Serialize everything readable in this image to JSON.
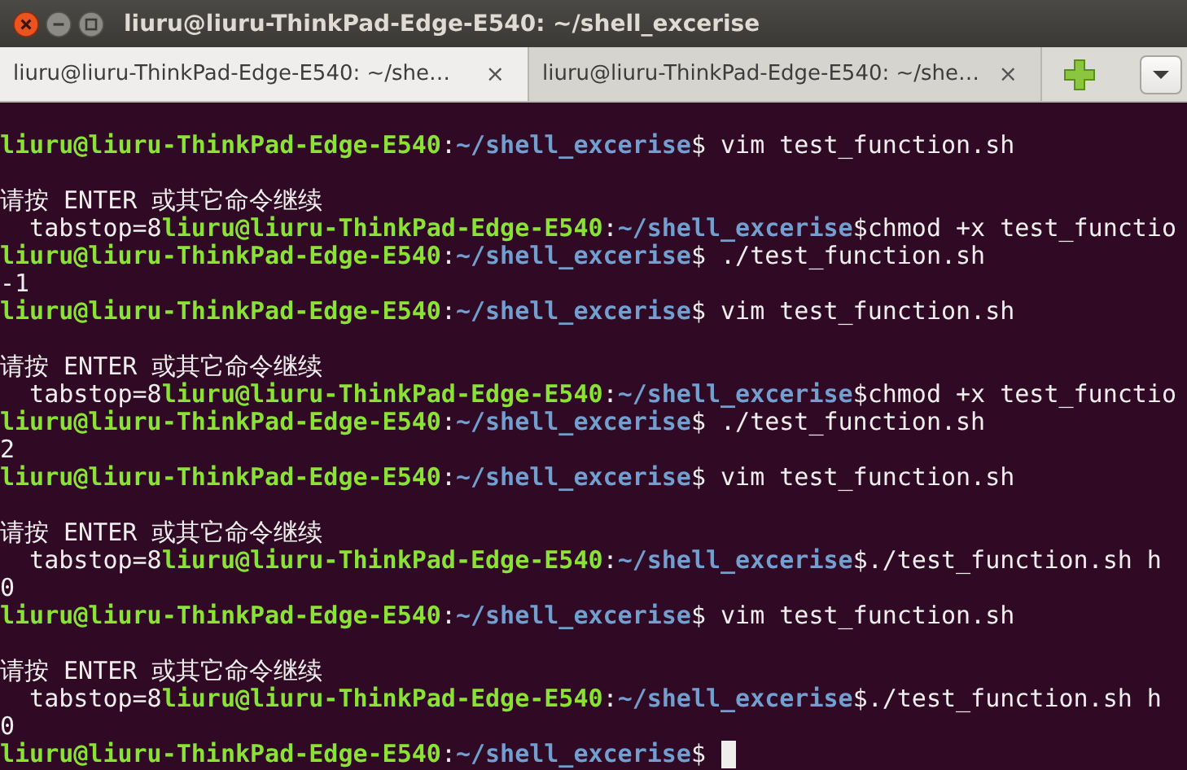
{
  "window": {
    "title": "liuru@liuru-ThinkPad-Edge-E540: ~/shell_excerise"
  },
  "tabs": [
    {
      "label": "liuru@liuru-ThinkPad-Edge-E540: ~/she…",
      "close": "×",
      "selected": true
    },
    {
      "label": "liuru@liuru-ThinkPad-Edge-E540: ~/she…",
      "close": "×",
      "selected": false
    }
  ],
  "terminal": {
    "lines": [
      {
        "kind": "output",
        "segments": [
          {
            "kind": "user",
            "text": "liuru@liuru-ThinkPad-Edge-E540"
          },
          {
            "kind": "plain",
            "text": ":"
          },
          {
            "kind": "path",
            "text": "~/shell_excerise"
          },
          {
            "kind": "plain",
            "text": "$ vim test_function.sh"
          }
        ]
      },
      {
        "kind": "blank"
      },
      {
        "kind": "output",
        "segments": [
          {
            "kind": "plain",
            "text": "请按 ENTER 或其它命令继续"
          }
        ]
      },
      {
        "kind": "output",
        "segments": [
          {
            "kind": "plain",
            "text": "  tabstop=8"
          },
          {
            "kind": "user",
            "text": "liuru@liuru-ThinkPad-Edge-E540"
          },
          {
            "kind": "plain",
            "text": ":"
          },
          {
            "kind": "path",
            "text": "~/shell_excerise"
          },
          {
            "kind": "plain",
            "text": "$chmod +x test_functio"
          }
        ]
      },
      {
        "kind": "output",
        "segments": [
          {
            "kind": "user",
            "text": "liuru@liuru-ThinkPad-Edge-E540"
          },
          {
            "kind": "plain",
            "text": ":"
          },
          {
            "kind": "path",
            "text": "~/shell_excerise"
          },
          {
            "kind": "plain",
            "text": "$ ./test_function.sh"
          }
        ]
      },
      {
        "kind": "output",
        "segments": [
          {
            "kind": "plain",
            "text": "-1"
          }
        ]
      },
      {
        "kind": "output",
        "segments": [
          {
            "kind": "user",
            "text": "liuru@liuru-ThinkPad-Edge-E540"
          },
          {
            "kind": "plain",
            "text": ":"
          },
          {
            "kind": "path",
            "text": "~/shell_excerise"
          },
          {
            "kind": "plain",
            "text": "$ vim test_function.sh"
          }
        ]
      },
      {
        "kind": "blank"
      },
      {
        "kind": "output",
        "segments": [
          {
            "kind": "plain",
            "text": "请按 ENTER 或其它命令继续"
          }
        ]
      },
      {
        "kind": "output",
        "segments": [
          {
            "kind": "plain",
            "text": "  tabstop=8"
          },
          {
            "kind": "user",
            "text": "liuru@liuru-ThinkPad-Edge-E540"
          },
          {
            "kind": "plain",
            "text": ":"
          },
          {
            "kind": "path",
            "text": "~/shell_excerise"
          },
          {
            "kind": "plain",
            "text": "$chmod +x test_functio"
          }
        ]
      },
      {
        "kind": "output",
        "segments": [
          {
            "kind": "user",
            "text": "liuru@liuru-ThinkPad-Edge-E540"
          },
          {
            "kind": "plain",
            "text": ":"
          },
          {
            "kind": "path",
            "text": "~/shell_excerise"
          },
          {
            "kind": "plain",
            "text": "$ ./test_function.sh"
          }
        ]
      },
      {
        "kind": "output",
        "segments": [
          {
            "kind": "plain",
            "text": "2"
          }
        ]
      },
      {
        "kind": "output",
        "segments": [
          {
            "kind": "user",
            "text": "liuru@liuru-ThinkPad-Edge-E540"
          },
          {
            "kind": "plain",
            "text": ":"
          },
          {
            "kind": "path",
            "text": "~/shell_excerise"
          },
          {
            "kind": "plain",
            "text": "$ vim test_function.sh"
          }
        ]
      },
      {
        "kind": "blank"
      },
      {
        "kind": "output",
        "segments": [
          {
            "kind": "plain",
            "text": "请按 ENTER 或其它命令继续"
          }
        ]
      },
      {
        "kind": "output",
        "segments": [
          {
            "kind": "plain",
            "text": "  tabstop=8"
          },
          {
            "kind": "user",
            "text": "liuru@liuru-ThinkPad-Edge-E540"
          },
          {
            "kind": "plain",
            "text": ":"
          },
          {
            "kind": "path",
            "text": "~/shell_excerise"
          },
          {
            "kind": "plain",
            "text": "$./test_function.sh h"
          }
        ]
      },
      {
        "kind": "output",
        "segments": [
          {
            "kind": "plain",
            "text": "0"
          }
        ]
      },
      {
        "kind": "output",
        "segments": [
          {
            "kind": "user",
            "text": "liuru@liuru-ThinkPad-Edge-E540"
          },
          {
            "kind": "plain",
            "text": ":"
          },
          {
            "kind": "path",
            "text": "~/shell_excerise"
          },
          {
            "kind": "plain",
            "text": "$ vim test_function.sh"
          }
        ]
      },
      {
        "kind": "blank"
      },
      {
        "kind": "output",
        "segments": [
          {
            "kind": "plain",
            "text": "请按 ENTER 或其它命令继续"
          }
        ]
      },
      {
        "kind": "output",
        "segments": [
          {
            "kind": "plain",
            "text": "  tabstop=8"
          },
          {
            "kind": "user",
            "text": "liuru@liuru-ThinkPad-Edge-E540"
          },
          {
            "kind": "plain",
            "text": ":"
          },
          {
            "kind": "path",
            "text": "~/shell_excerise"
          },
          {
            "kind": "plain",
            "text": "$./test_function.sh h"
          }
        ]
      },
      {
        "kind": "output",
        "segments": [
          {
            "kind": "plain",
            "text": "0"
          }
        ]
      },
      {
        "kind": "output",
        "cursor": true,
        "segments": [
          {
            "kind": "user",
            "text": "liuru@liuru-ThinkPad-Edge-E540"
          },
          {
            "kind": "plain",
            "text": ":"
          },
          {
            "kind": "path",
            "text": "~/shell_excerise"
          },
          {
            "kind": "plain",
            "text": "$ "
          }
        ]
      }
    ]
  }
}
